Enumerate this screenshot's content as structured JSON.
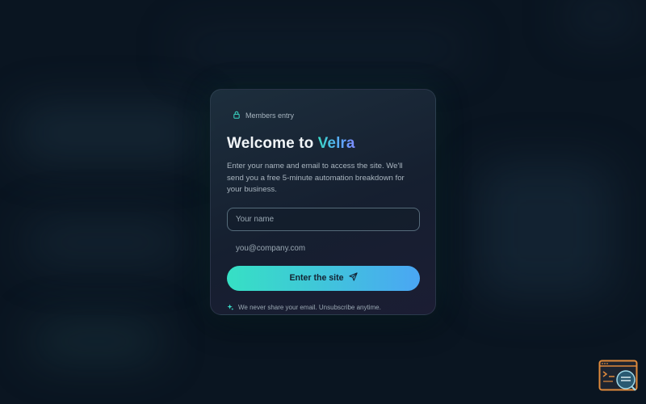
{
  "badge": {
    "label": "Members entry",
    "icon": "lock-icon"
  },
  "title": {
    "prefix": "Welcome to ",
    "brand": "Velra"
  },
  "description": "Enter your name and email to access the site. We'll send you a free 5-minute automation breakdown for your business.",
  "form": {
    "name_placeholder": "Your name",
    "email_placeholder": "you@company.com",
    "submit_label": "Enter the site",
    "submit_icon": "send-icon"
  },
  "note": {
    "text": "We never share your email. Unsubscribe anytime.",
    "icon": "sparkle-icon"
  },
  "colors": {
    "accent_start": "#36e0c4",
    "accent_end": "#4aa6f4",
    "background": "#0a1521",
    "widget": "#e08a3c"
  }
}
